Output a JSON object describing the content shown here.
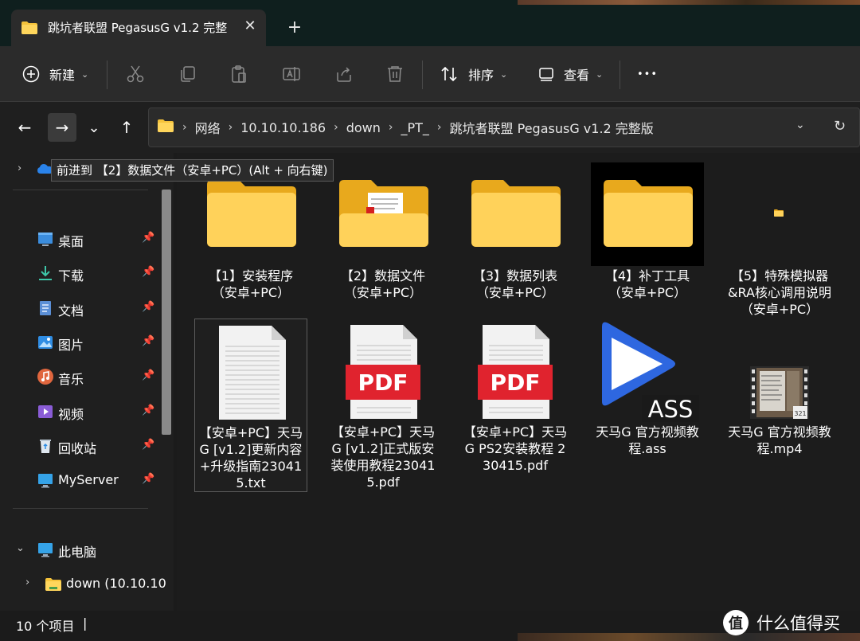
{
  "window": {
    "tab_title": "跳坑者联盟 PegasusG v1.2 完整",
    "close_glyph": "✕",
    "new_tab_glyph": "+"
  },
  "toolbar": {
    "new_label": "新建",
    "sort_label": "排序",
    "view_label": "查看",
    "more_glyph": "•••"
  },
  "nav": {
    "back_glyph": "←",
    "forward_glyph": "→",
    "recent_glyph": "⌄",
    "up_glyph": "↑",
    "breadcrumbs": [
      "网络",
      "10.10.10.186",
      "down",
      "_PT_",
      "跳坑者联盟 PegasusG v1.2 完整版"
    ],
    "crumb_sep": "›",
    "dropdown_glyph": "⌄",
    "refresh_glyph": "↻"
  },
  "tooltip": "前进到 【2】数据文件（安卓+PC）(Alt + 向右键)",
  "sidebar": {
    "quick_access": [
      {
        "label": "桌面",
        "icon": "desktop-icon"
      },
      {
        "label": "下载",
        "icon": "download-icon"
      },
      {
        "label": "文档",
        "icon": "documents-icon"
      },
      {
        "label": "图片",
        "icon": "pictures-icon"
      },
      {
        "label": "音乐",
        "icon": "music-icon"
      },
      {
        "label": "视频",
        "icon": "videos-icon"
      },
      {
        "label": "回收站",
        "icon": "recycle-bin-icon"
      },
      {
        "label": "MyServer",
        "icon": "monitor-icon"
      }
    ],
    "this_pc": "此电脑",
    "drive": "down (10.10.10",
    "pin_glyph": "📌"
  },
  "files": [
    {
      "name": "【1】安装程序（安卓+PC）",
      "type": "folder"
    },
    {
      "name": "【2】数据文件（安卓+PC）",
      "type": "folder-doc"
    },
    {
      "name": "【3】数据列表（安卓+PC）",
      "type": "folder"
    },
    {
      "name": "【4】补丁工具（安卓+PC）",
      "type": "folder-dark"
    },
    {
      "name": "【5】特殊模拟器&RA核心调用说明（安卓+PC）",
      "type": "folder-tiny"
    },
    {
      "name": "【安卓+PC】天马G [v1.2]更新内容+升级指南230415.txt",
      "type": "txt"
    },
    {
      "name": "【安卓+PC】天马G [v1.2]正式版安装使用教程230415.pdf",
      "type": "pdf"
    },
    {
      "name": "【安卓+PC】天马G PS2安装教程 230415.pdf",
      "type": "pdf"
    },
    {
      "name": "天马G 官方视频教程.ass",
      "type": "ass"
    },
    {
      "name": "天马G 官方视频教程.mp4",
      "type": "mp4"
    }
  ],
  "icon_text": {
    "pdf": "PDF",
    "ass": "ASS",
    "mp4_badge": "321"
  },
  "status": {
    "count": "10 个项目",
    "bar": "|"
  },
  "brand": {
    "badge": "值",
    "text": "什么值得买"
  },
  "colors": {
    "folder": "#f5c33b",
    "folder_dark": "#e8a91d",
    "pdf_red": "#e0232e",
    "play_blue": "#2e67e0",
    "accent": "#4aa3ff"
  }
}
